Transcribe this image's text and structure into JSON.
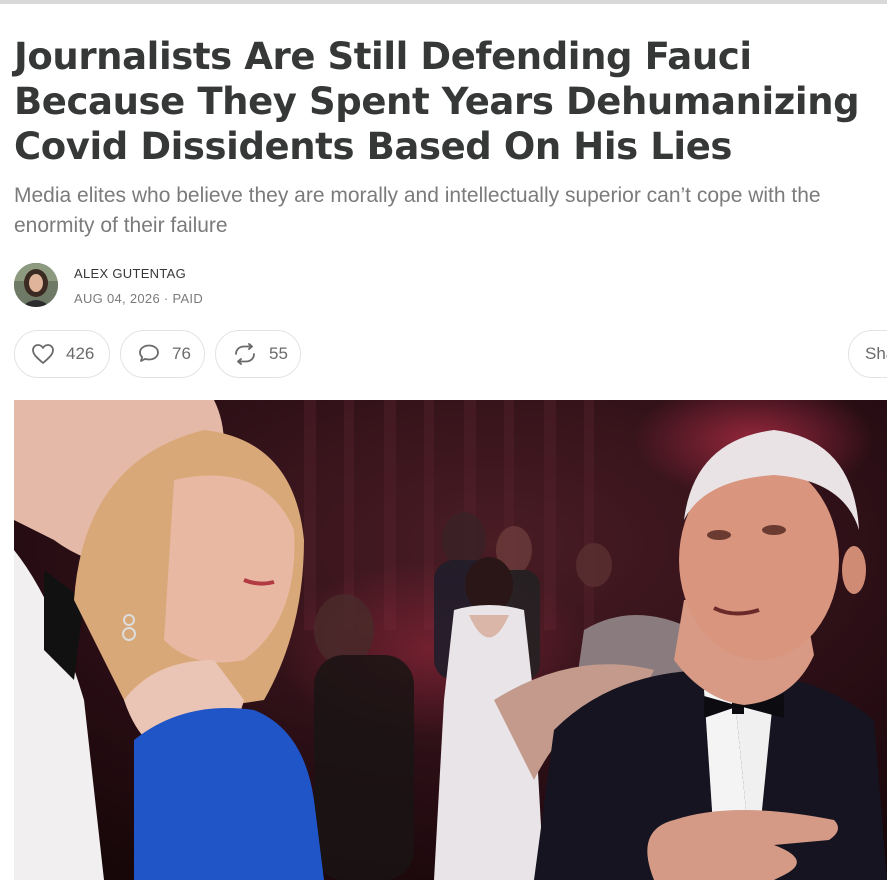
{
  "post": {
    "title": "Journalists Are Still Defending Fauci Because They Spent Years Dehumanizing Covid Dissidents Based On His Lies",
    "subtitle_line1": "Media elites who believe they are morally and intellectually superior can’t cope with the",
    "subtitle_line2": "enormity of their failure",
    "author": "ALEX GUTENTAG",
    "meta": "AUG 04, 2026 · PAID"
  },
  "actions": {
    "likes": "426",
    "comments": "76",
    "restacks": "55",
    "share_label": "Sha"
  },
  "icons": {
    "like": "heart-icon",
    "comment": "comment-bubble-icon",
    "restack": "restack-icon"
  },
  "colors": {
    "text_dark": "#363737",
    "text_muted": "#7b7b7b",
    "pill_border": "#e3e3e3"
  }
}
